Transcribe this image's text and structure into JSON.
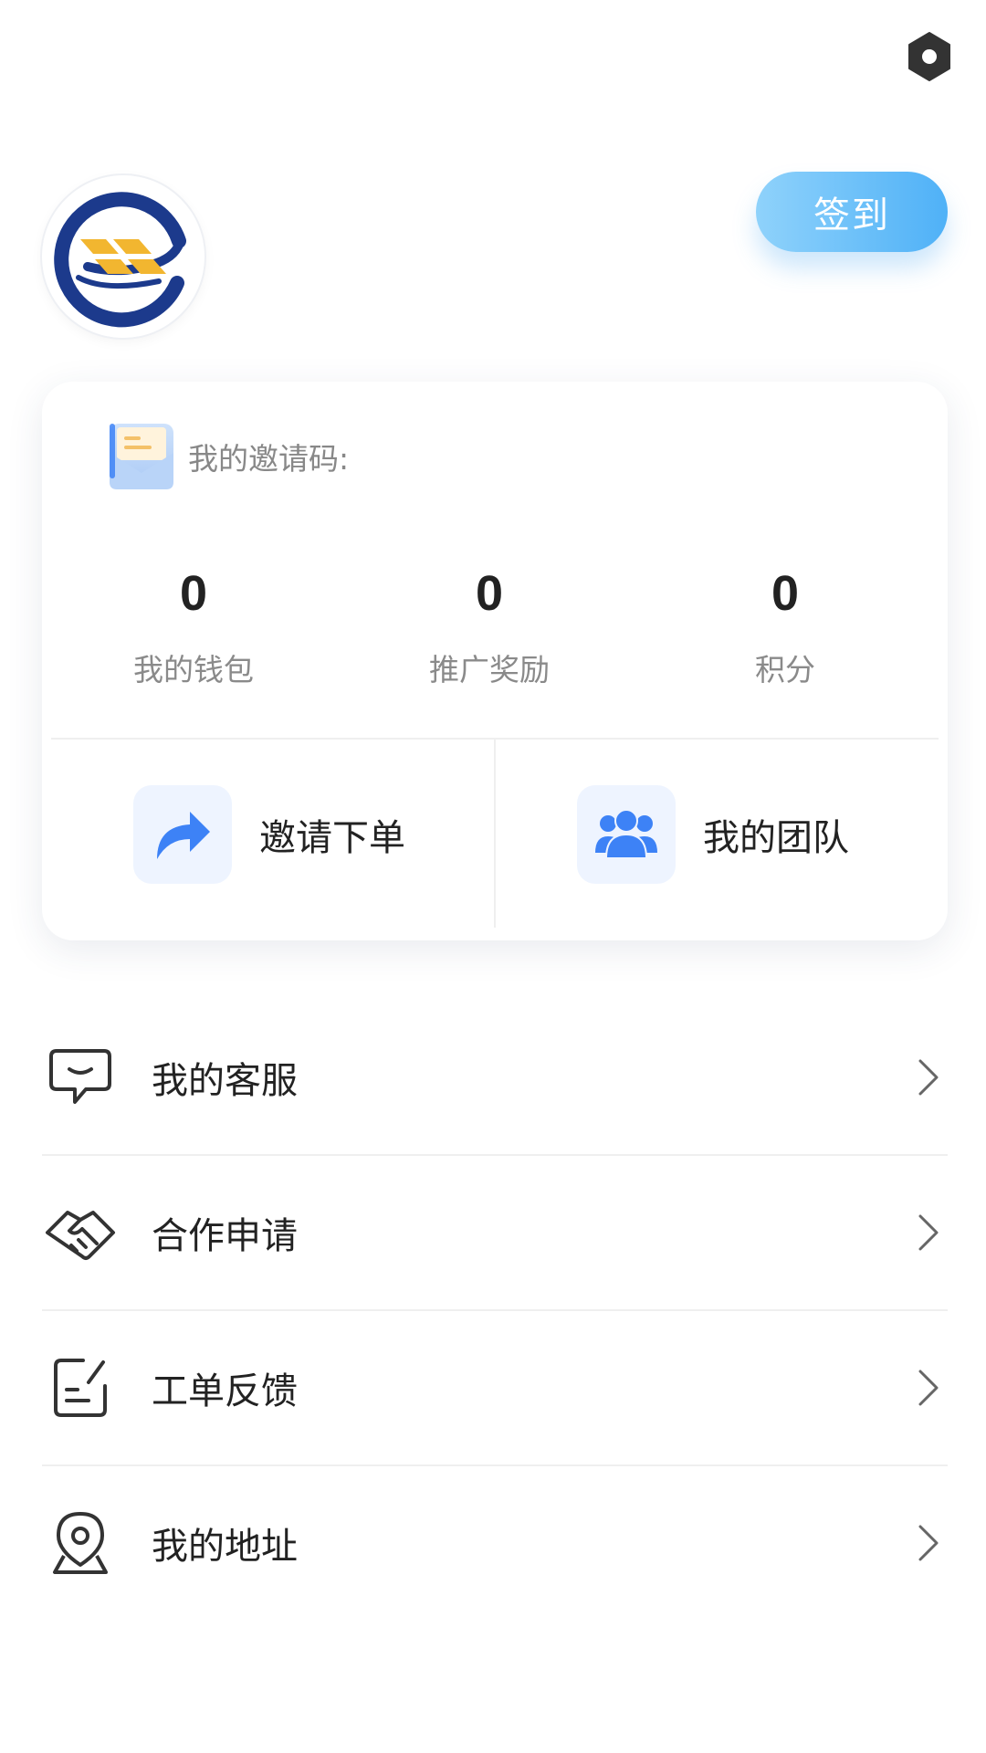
{
  "header": {
    "settings_icon": "settings-hexagon-icon",
    "checkin_label": "签到"
  },
  "profile": {
    "avatar_icon": "company-logo"
  },
  "card": {
    "invite_code_label": "我的邀请码:",
    "invite_code_icon": "envelope-icon",
    "stats": [
      {
        "value": "0",
        "label": "我的钱包"
      },
      {
        "value": "0",
        "label": "推广奖励"
      },
      {
        "value": "0",
        "label": "积分"
      }
    ],
    "actions": [
      {
        "label": "邀请下单",
        "icon": "share-arrow-icon"
      },
      {
        "label": "我的团队",
        "icon": "team-icon"
      }
    ]
  },
  "menu": {
    "items": [
      {
        "label": "我的客服",
        "icon": "chat-service-icon"
      },
      {
        "label": "合作申请",
        "icon": "handshake-icon"
      },
      {
        "label": "工单反馈",
        "icon": "feedback-edit-icon"
      },
      {
        "label": "我的地址",
        "icon": "location-pin-icon"
      }
    ]
  },
  "colors": {
    "accent": "#4fb1f7",
    "icon_blue": "#3d82f6",
    "logo_navy": "#1c3a8c",
    "logo_gold": "#f2b630"
  }
}
